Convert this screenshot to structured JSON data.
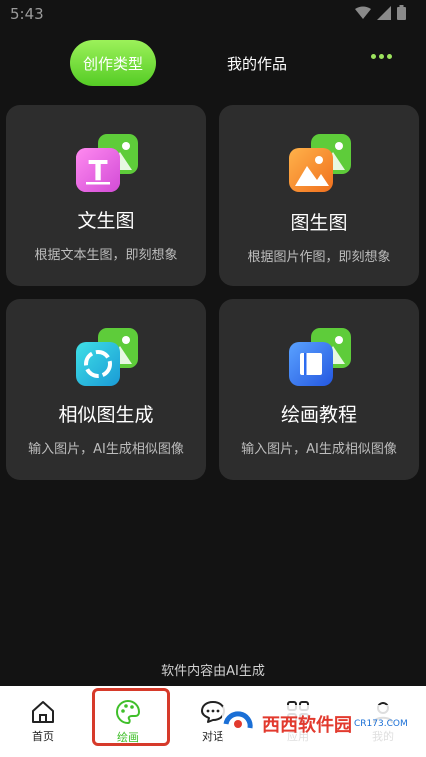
{
  "status": {
    "time": "5:43"
  },
  "tabs": {
    "active": "创作类型",
    "inactive": "我的作品"
  },
  "cards": [
    {
      "title": "文生图",
      "desc": "根据文本生图，即刻想象",
      "icon": "text-to-image-icon"
    },
    {
      "title": "图生图",
      "desc": "根据图片作图，即刻想象",
      "icon": "image-to-image-icon"
    },
    {
      "title": "相似图生成",
      "desc": "输入图片，AI生成相似图像",
      "icon": "similar-image-icon"
    },
    {
      "title": "绘画教程",
      "desc": "输入图片，AI生成相似图像",
      "icon": "tutorial-book-icon"
    }
  ],
  "disclaimer": "软件内容由AI生成",
  "nav": [
    {
      "label": "首页",
      "icon": "home-icon"
    },
    {
      "label": "绘画",
      "icon": "palette-icon"
    },
    {
      "label": "对话",
      "icon": "chat-icon"
    },
    {
      "label": "应用",
      "icon": "apps-icon"
    },
    {
      "label": "我的",
      "icon": "profile-icon"
    }
  ],
  "watermark": {
    "brand": "西西软件园",
    "domain": "CR173.COM"
  },
  "colors": {
    "accent": "#7ddc3e",
    "background": "#131313",
    "card": "#2d2d2d"
  }
}
